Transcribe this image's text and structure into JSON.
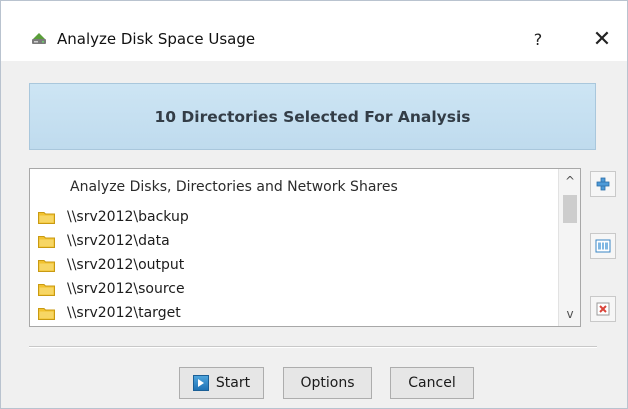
{
  "window": {
    "title": "Analyze Disk Space Usage",
    "help_label": "?",
    "close_label": "✕"
  },
  "banner": {
    "text": "10 Directories Selected For Analysis"
  },
  "list": {
    "header": "Analyze Disks, Directories and Network Shares",
    "items": [
      {
        "label": "\\\\srv2012\\backup",
        "icon": "folder-icon"
      },
      {
        "label": "\\\\srv2012\\data",
        "icon": "folder-icon"
      },
      {
        "label": "\\\\srv2012\\output",
        "icon": "folder-icon"
      },
      {
        "label": "\\\\srv2012\\source",
        "icon": "folder-icon"
      },
      {
        "label": "\\\\srv2012\\target",
        "icon": "folder-icon"
      }
    ],
    "scroll_up_label": "^",
    "scroll_down_label": "v"
  },
  "side_buttons": [
    {
      "icon": "add-icon"
    },
    {
      "icon": "properties-icon"
    },
    {
      "icon": "remove-icon"
    }
  ],
  "buttons": {
    "start_label": "Start",
    "options_label": "Options",
    "cancel_label": "Cancel"
  },
  "colors": {
    "banner_bg": "#c5dff0",
    "folder": "#f2c230",
    "accent_blue": "#1f72b5",
    "remove_red": "#d9443a"
  }
}
